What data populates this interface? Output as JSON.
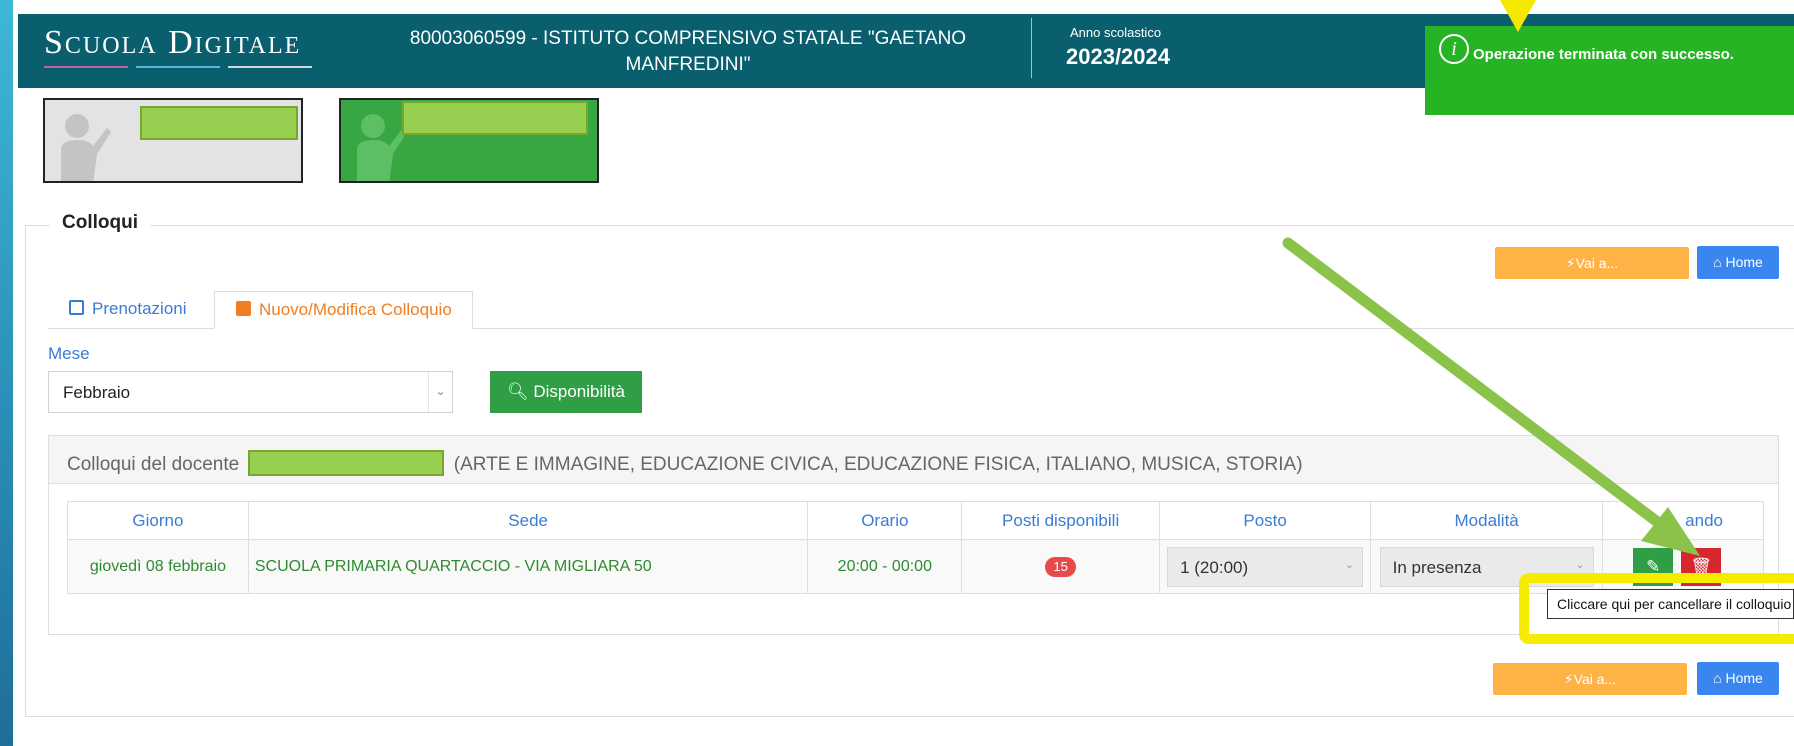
{
  "header": {
    "logo_text": "Scuola Digitale",
    "school_name": "80003060599 - ISTITUTO COMPRENSIVO STATALE \"GAETANO MANFREDINI\"",
    "year_label": "Anno scolastico",
    "year_value": "2023/2024"
  },
  "toast": {
    "icon": "info-icon",
    "text": "Operazione terminata con successo."
  },
  "colors": {
    "header_bg": "#0a5f6f",
    "toast_bg": "#27b424",
    "accent_blue": "#3a7bd5",
    "accent_orange": "#f07e22",
    "button_green": "#2f9e44",
    "button_red": "#d7262d",
    "button_orange": "#ffb347",
    "button_blue": "#3a86f0",
    "annotation_yellow": "#f5ec00",
    "annotation_green": "#8bc34a"
  },
  "section": {
    "title": "Colloqui",
    "vai_label": "Vai a...",
    "home_label": "Home"
  },
  "tabs": [
    {
      "label": "Prenotazioni",
      "icon": "calendar-check-icon"
    },
    {
      "label": "Nuovo/Modifica Colloquio",
      "icon": "calendar-add-icon"
    }
  ],
  "filter": {
    "mese_label": "Mese",
    "mese_value": "Febbraio",
    "disponibilita_label": "Disponibilità"
  },
  "panel": {
    "title_prefix": "Colloqui del docente",
    "subjects": "(ARTE E IMMAGINE, EDUCAZIONE CIVICA, EDUCAZIONE FISICA, ITALIANO, MUSICA, STORIA)"
  },
  "table": {
    "headers": [
      "Giorno",
      "Sede",
      "Orario",
      "Posti disponibili",
      "Posto",
      "Modalità",
      "Comando"
    ],
    "header_comando_visible": "ando",
    "rows": [
      {
        "giorno": "giovedì 08 febbraio",
        "sede": "SCUOLA PRIMARIA QUARTACCIO - VIA MIGLIARA 50",
        "orario": "20:00 - 00:00",
        "posti": "15",
        "posto": "1 (20:00)",
        "modalita": "In presenza"
      }
    ]
  },
  "tooltip": {
    "text": "Cliccare qui per cancellare il colloquio"
  }
}
